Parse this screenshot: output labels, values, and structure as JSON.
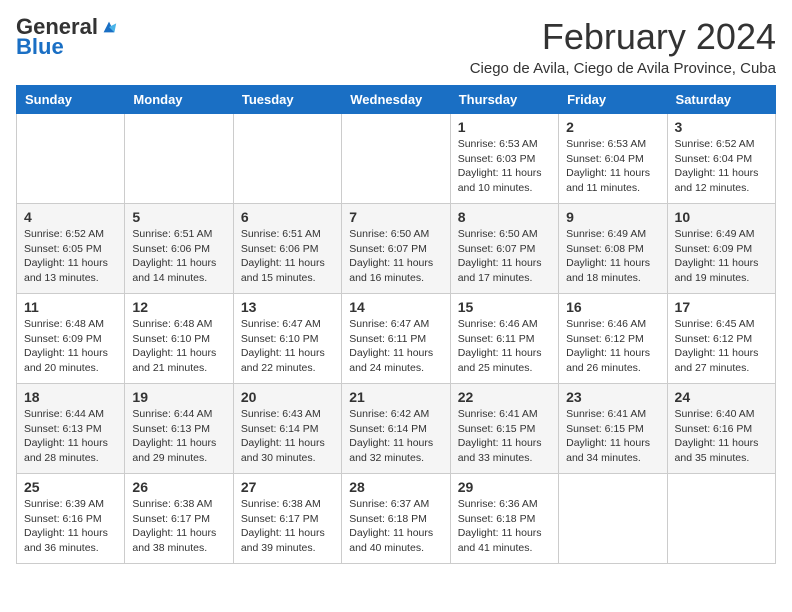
{
  "header": {
    "logo_general": "General",
    "logo_blue": "Blue",
    "month_title": "February 2024",
    "location": "Ciego de Avila, Ciego de Avila Province, Cuba"
  },
  "columns": [
    "Sunday",
    "Monday",
    "Tuesday",
    "Wednesday",
    "Thursday",
    "Friday",
    "Saturday"
  ],
  "weeks": [
    [
      {
        "day": "",
        "info": ""
      },
      {
        "day": "",
        "info": ""
      },
      {
        "day": "",
        "info": ""
      },
      {
        "day": "",
        "info": ""
      },
      {
        "day": "1",
        "info": "Sunrise: 6:53 AM\nSunset: 6:03 PM\nDaylight: 11 hours and 10 minutes."
      },
      {
        "day": "2",
        "info": "Sunrise: 6:53 AM\nSunset: 6:04 PM\nDaylight: 11 hours and 11 minutes."
      },
      {
        "day": "3",
        "info": "Sunrise: 6:52 AM\nSunset: 6:04 PM\nDaylight: 11 hours and 12 minutes."
      }
    ],
    [
      {
        "day": "4",
        "info": "Sunrise: 6:52 AM\nSunset: 6:05 PM\nDaylight: 11 hours and 13 minutes."
      },
      {
        "day": "5",
        "info": "Sunrise: 6:51 AM\nSunset: 6:06 PM\nDaylight: 11 hours and 14 minutes."
      },
      {
        "day": "6",
        "info": "Sunrise: 6:51 AM\nSunset: 6:06 PM\nDaylight: 11 hours and 15 minutes."
      },
      {
        "day": "7",
        "info": "Sunrise: 6:50 AM\nSunset: 6:07 PM\nDaylight: 11 hours and 16 minutes."
      },
      {
        "day": "8",
        "info": "Sunrise: 6:50 AM\nSunset: 6:07 PM\nDaylight: 11 hours and 17 minutes."
      },
      {
        "day": "9",
        "info": "Sunrise: 6:49 AM\nSunset: 6:08 PM\nDaylight: 11 hours and 18 minutes."
      },
      {
        "day": "10",
        "info": "Sunrise: 6:49 AM\nSunset: 6:09 PM\nDaylight: 11 hours and 19 minutes."
      }
    ],
    [
      {
        "day": "11",
        "info": "Sunrise: 6:48 AM\nSunset: 6:09 PM\nDaylight: 11 hours and 20 minutes."
      },
      {
        "day": "12",
        "info": "Sunrise: 6:48 AM\nSunset: 6:10 PM\nDaylight: 11 hours and 21 minutes."
      },
      {
        "day": "13",
        "info": "Sunrise: 6:47 AM\nSunset: 6:10 PM\nDaylight: 11 hours and 22 minutes."
      },
      {
        "day": "14",
        "info": "Sunrise: 6:47 AM\nSunset: 6:11 PM\nDaylight: 11 hours and 24 minutes."
      },
      {
        "day": "15",
        "info": "Sunrise: 6:46 AM\nSunset: 6:11 PM\nDaylight: 11 hours and 25 minutes."
      },
      {
        "day": "16",
        "info": "Sunrise: 6:46 AM\nSunset: 6:12 PM\nDaylight: 11 hours and 26 minutes."
      },
      {
        "day": "17",
        "info": "Sunrise: 6:45 AM\nSunset: 6:12 PM\nDaylight: 11 hours and 27 minutes."
      }
    ],
    [
      {
        "day": "18",
        "info": "Sunrise: 6:44 AM\nSunset: 6:13 PM\nDaylight: 11 hours and 28 minutes."
      },
      {
        "day": "19",
        "info": "Sunrise: 6:44 AM\nSunset: 6:13 PM\nDaylight: 11 hours and 29 minutes."
      },
      {
        "day": "20",
        "info": "Sunrise: 6:43 AM\nSunset: 6:14 PM\nDaylight: 11 hours and 30 minutes."
      },
      {
        "day": "21",
        "info": "Sunrise: 6:42 AM\nSunset: 6:14 PM\nDaylight: 11 hours and 32 minutes."
      },
      {
        "day": "22",
        "info": "Sunrise: 6:41 AM\nSunset: 6:15 PM\nDaylight: 11 hours and 33 minutes."
      },
      {
        "day": "23",
        "info": "Sunrise: 6:41 AM\nSunset: 6:15 PM\nDaylight: 11 hours and 34 minutes."
      },
      {
        "day": "24",
        "info": "Sunrise: 6:40 AM\nSunset: 6:16 PM\nDaylight: 11 hours and 35 minutes."
      }
    ],
    [
      {
        "day": "25",
        "info": "Sunrise: 6:39 AM\nSunset: 6:16 PM\nDaylight: 11 hours and 36 minutes."
      },
      {
        "day": "26",
        "info": "Sunrise: 6:38 AM\nSunset: 6:17 PM\nDaylight: 11 hours and 38 minutes."
      },
      {
        "day": "27",
        "info": "Sunrise: 6:38 AM\nSunset: 6:17 PM\nDaylight: 11 hours and 39 minutes."
      },
      {
        "day": "28",
        "info": "Sunrise: 6:37 AM\nSunset: 6:18 PM\nDaylight: 11 hours and 40 minutes."
      },
      {
        "day": "29",
        "info": "Sunrise: 6:36 AM\nSunset: 6:18 PM\nDaylight: 11 hours and 41 minutes."
      },
      {
        "day": "",
        "info": ""
      },
      {
        "day": "",
        "info": ""
      }
    ]
  ]
}
